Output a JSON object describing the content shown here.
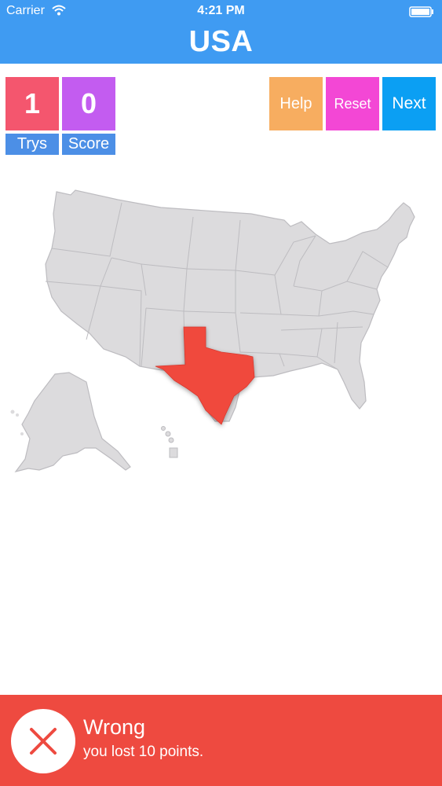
{
  "status_bar": {
    "carrier": "Carrier",
    "time": "4:21 PM"
  },
  "header": {
    "title": "USA",
    "color": "#3f9bf2"
  },
  "counters": {
    "trys": {
      "value": "1",
      "label": "Trys"
    },
    "score": {
      "value": "0",
      "label": "Score"
    }
  },
  "actions": {
    "help": "Help",
    "reset": "Reset",
    "next": "Next"
  },
  "map": {
    "highlighted_state": "Texas",
    "highlight_color": "#f0493e",
    "base_color": "#dcdbdd"
  },
  "feedback": {
    "title": "Wrong",
    "message": "you lost 10 points.",
    "icon": "x-icon",
    "color": "#ee4a40"
  }
}
